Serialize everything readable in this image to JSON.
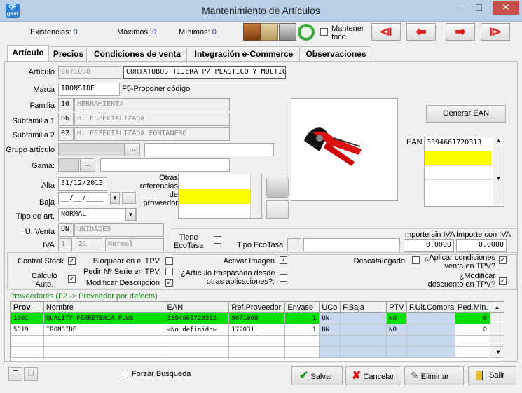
{
  "window": {
    "title": "Mantenimiento de Artículos",
    "app_icon_text": "QF\ngest"
  },
  "stats": {
    "existencias_label": "Existencias:",
    "existencias_value": "0",
    "maximos_label": "Máximos:",
    "maximos_value": "0",
    "minimos_label": "Mínimos:",
    "minimos_value": "0"
  },
  "toolbar": {
    "mantener_foco_label": "Mantener\nfoco"
  },
  "tabs": [
    {
      "label": "Artículo"
    },
    {
      "label": "Precios"
    },
    {
      "label": "Condiciones de venta"
    },
    {
      "label": "Integración e-Commerce"
    },
    {
      "label": "Observaciones"
    }
  ],
  "form": {
    "articulo_label": "Artículo",
    "articulo_code": "9671098",
    "articulo_desc": "CORTATUBOS TIJERA P/ PLASTICO Y MULTIC",
    "marca_label": "Marca",
    "marca_value": "IRONSIDE",
    "marca_hint": "F5-Proponer código",
    "familia_label": "Familia",
    "familia_code": "10",
    "familia_desc": "HERRAMIENTA",
    "subfamilia1_label": "Subfamilia 1",
    "subfamilia1_code": "06",
    "subfamilia1_desc": "H. ESPECIALIZADA",
    "subfamilia2_label": "Subfamilia 2",
    "subfamilia2_code": "02",
    "subfamilia2_desc": "H. ESPECIALIZADA FONTANERO",
    "grupo_label": "Grupo artículo",
    "gama_label": "Gama:",
    "alta_label": "Alta",
    "alta_value": "31/12/2013",
    "baja_label": "Baja",
    "baja_value": "__/__/____",
    "tipo_label": "Tipo de art.",
    "tipo_value": "NORMAL",
    "uventa_label": "U. Venta",
    "uventa_code": "UN",
    "uventa_desc": "UNIDADES",
    "iva_label": "IVA",
    "iva_code": "1",
    "iva_pct": "21",
    "iva_desc": "Normal",
    "otras_ref_label": "Otras\nreferencias\nde\nproveedor",
    "ean_label": "EAN",
    "generar_ean_label": "Generar EAN",
    "ean_values": [
      "3394661720313"
    ],
    "ecotasa_label": "Tiene\nEcoTasa",
    "tipo_ecotasa_label": "Tipo EcoTasa",
    "importe_sin_iva_label": "Importe sin IVA",
    "importe_sin_iva": "0.0000",
    "importe_con_iva_label": "Importe con IVA",
    "importe_con_iva": "0.0000"
  },
  "checks": {
    "control_stock": "Control Stock",
    "calculo_auto": "Cálculo\nAuto.",
    "bloquear_tpv": "Bloquear en el TPV",
    "pedir_serie": "Pedir Nº Serie en TPV",
    "modificar_desc": "Modificar Descripción",
    "activar_imagen": "Activar Imagen",
    "traspasado": "¿Artículo traspasado desde\notras aplicaciones?:",
    "descatalogado": "Descatalogado",
    "aplicar_condiciones": "¿Aplicar condiciones\nventa en TPV?",
    "modificar_descuento": "¿Modificar\ndescuento en TPV?"
  },
  "providers": {
    "title": "Proveedores (F2 -> Proveedor por defecto)",
    "columns": [
      "Prov",
      "Nombre",
      "EAN",
      "Ref.Proveedor",
      "Envase",
      "UCo",
      "F.Baja",
      "PTV",
      "F.Ult.Compra",
      "Ped.Min."
    ],
    "rows": [
      [
        "1001",
        "QUALITY FERRETERIA PLUS",
        "3394661720313",
        "9671098",
        "1",
        "UN",
        "",
        "NO",
        "",
        "0"
      ],
      [
        "5019",
        "IRONSIDE",
        "<No definido>",
        "172031",
        "1",
        "UN",
        "",
        "NO",
        "",
        "0"
      ]
    ]
  },
  "footer": {
    "forzar_busqueda": "Forzar Búsqueda",
    "salvar": "Salvar",
    "cancelar": "Cancelar",
    "eliminar": "Eliminar",
    "salir": "Salir"
  }
}
